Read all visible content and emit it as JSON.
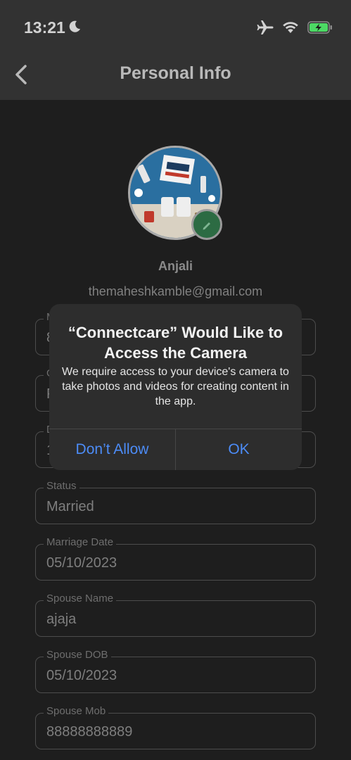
{
  "status_bar": {
    "time": "13:21",
    "icons": [
      "moon-icon",
      "airplane-icon",
      "wifi-icon",
      "battery-charging-icon"
    ]
  },
  "header": {
    "title": "Personal Info",
    "back_icon": "chevron-left-icon"
  },
  "profile": {
    "name": "Anjali",
    "email": "themaheshkamble@gmail.com",
    "edit_icon": "pencil-icon"
  },
  "fields": [
    {
      "label": "M",
      "value": "8"
    },
    {
      "label": "G",
      "value": "F"
    },
    {
      "label": "D",
      "value": "1"
    },
    {
      "label": "Status",
      "value": "Married"
    },
    {
      "label": "Marriage Date",
      "value": "05/10/2023"
    },
    {
      "label": "Spouse Name",
      "value": "ajaja"
    },
    {
      "label": "Spouse DOB",
      "value": "05/10/2023"
    },
    {
      "label": "Spouse Mob",
      "value": "88888888889"
    }
  ],
  "dialog": {
    "title": "“Connectcare” Would Like to Access the Camera",
    "message": "We require access to your device's camera to take photos and videos for creating content in the app.",
    "deny_label": "Don’t Allow",
    "ok_label": "OK"
  },
  "colors": {
    "accent": "#4c8cf7",
    "battery_green": "#4cd964",
    "badge_green": "#2c6b43"
  }
}
